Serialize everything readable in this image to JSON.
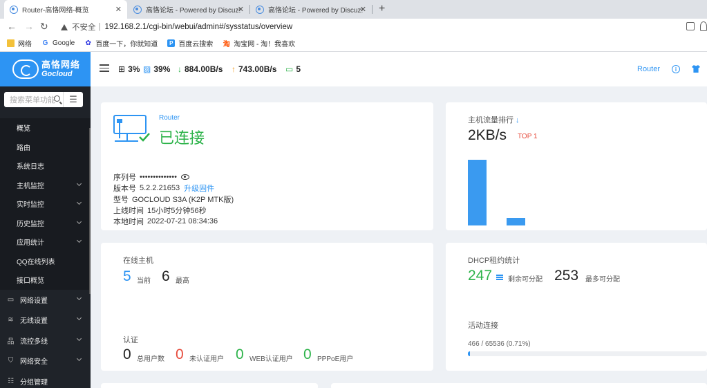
{
  "browser": {
    "tabs": [
      {
        "title": "Router-高恪网络-概览",
        "active": true
      },
      {
        "title": "高恪论坛 - Powered by Discuz!",
        "active": false
      },
      {
        "title": "高恪论坛 - Powered by Discuz!",
        "active": false
      }
    ],
    "security_label": "不安全",
    "url": "192.168.2.1/cgi-bin/webui/admin#/sysstatus/overview",
    "bookmarks": [
      {
        "label": "网络",
        "icon": "folder-icon"
      },
      {
        "label": "Google",
        "icon": "google-icon"
      },
      {
        "label": "百度一下，你就知道",
        "icon": "baidu-icon"
      },
      {
        "label": "百度云搜索",
        "icon": "baiduyun-icon"
      },
      {
        "label": "淘宝网 - 淘！我喜欢",
        "icon": "taobao-icon"
      }
    ]
  },
  "brand": {
    "cn": "高恪网络",
    "en": "Gocloud"
  },
  "search": {
    "placeholder": "搜索菜单功能"
  },
  "menu": {
    "sub_items": [
      {
        "label": "概览",
        "active": true,
        "chevron": false
      },
      {
        "label": "路由",
        "active": false,
        "chevron": false
      },
      {
        "label": "系统日志",
        "active": false,
        "chevron": false
      },
      {
        "label": "主机监控",
        "active": false,
        "chevron": true
      },
      {
        "label": "实时监控",
        "active": false,
        "chevron": true
      },
      {
        "label": "历史监控",
        "active": false,
        "chevron": true
      },
      {
        "label": "应用统计",
        "active": false,
        "chevron": true
      },
      {
        "label": "QQ在线列表",
        "active": false,
        "chevron": false
      },
      {
        "label": "接口概览",
        "active": false,
        "chevron": false
      }
    ],
    "top_items": [
      {
        "label": "网络设置",
        "icon": "monitor-icon"
      },
      {
        "label": "无线设置",
        "icon": "wifi-icon"
      },
      {
        "label": "流控多线",
        "icon": "network-icon"
      },
      {
        "label": "网络安全",
        "icon": "shield-icon"
      },
      {
        "label": "分组管理",
        "icon": "group-icon"
      }
    ]
  },
  "topbar": {
    "cpu": "3%",
    "memory": "39%",
    "download": "884.00B/s",
    "upload": "743.00B/s",
    "hosts": "5",
    "router_label": "Router",
    "colors": {
      "download": "#2db34a",
      "upload": "#f29b1d",
      "hosts": "#2db34a"
    }
  },
  "status_card": {
    "name": "Router",
    "state": "已连接",
    "serial_label": "序列号",
    "serial_value": "••••••••••••••",
    "version_label": "版本号",
    "version_value": "5.2.2.21653",
    "upgrade_link": "升级固件",
    "model_label": "型号",
    "model_value": "GOCLOUD S3A (K2P MTK版)",
    "uptime_label": "上线时间",
    "uptime_value": "15小时5分钟56秒",
    "localtime_label": "本地时间",
    "localtime_value": "2022-07-21 08:34:36"
  },
  "traffic_card": {
    "title": "主机流量排行",
    "rate": "2KB/s",
    "rank": "TOP 1",
    "bars": [
      1.0,
      0.12
    ]
  },
  "hosts_card": {
    "title": "在线主机",
    "current": "5",
    "current_label": "当前",
    "max": "6",
    "max_label": "最高",
    "auth_title": "认证",
    "total_users": "0",
    "total_users_label": "总用户数",
    "unauth_users": "0",
    "unauth_users_label": "未认证用户",
    "web_users": "0",
    "web_users_label": "WEB认证用户",
    "pppoe_users": "0",
    "pppoe_users_label": "PPPoE用户"
  },
  "dhcp_card": {
    "title": "DHCP租约统计",
    "remaining": "247",
    "remaining_label": "剩余可分配",
    "max": "253",
    "max_label": "最多可分配",
    "conn_title": "活动连接",
    "conn_ratio": "466 / 65536 (0.71%)",
    "conn_fraction": 0.0071
  }
}
